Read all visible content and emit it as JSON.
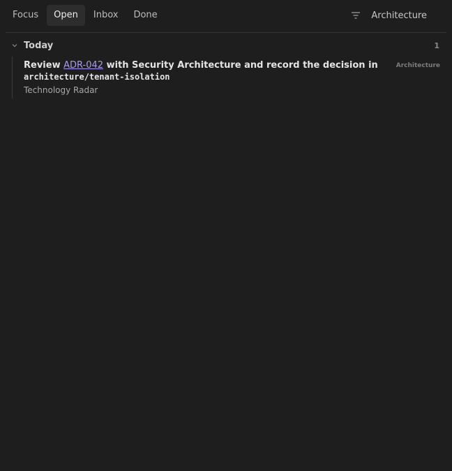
{
  "tabs": [
    {
      "label": "Focus",
      "active": false
    },
    {
      "label": "Open",
      "active": true
    },
    {
      "label": "Inbox",
      "active": false
    },
    {
      "label": "Done",
      "active": false
    }
  ],
  "filter": {
    "icon": "filter-icon",
    "value": "Architecture"
  },
  "group": {
    "icon": "chevron-down-icon",
    "title": "Today",
    "count": "1"
  },
  "tasks": [
    {
      "title_prefix": "Review ",
      "link_text": "ADR-042",
      "title_middle": " with Security Architecture and record the decision in ",
      "code_text": "architecture/tenant-isolation",
      "project": "Technology Radar",
      "tag": "Architecture"
    }
  ],
  "colors": {
    "background": "#1e1e1e",
    "active_tab": "#2d2d2d",
    "link": "#a79cf0"
  }
}
